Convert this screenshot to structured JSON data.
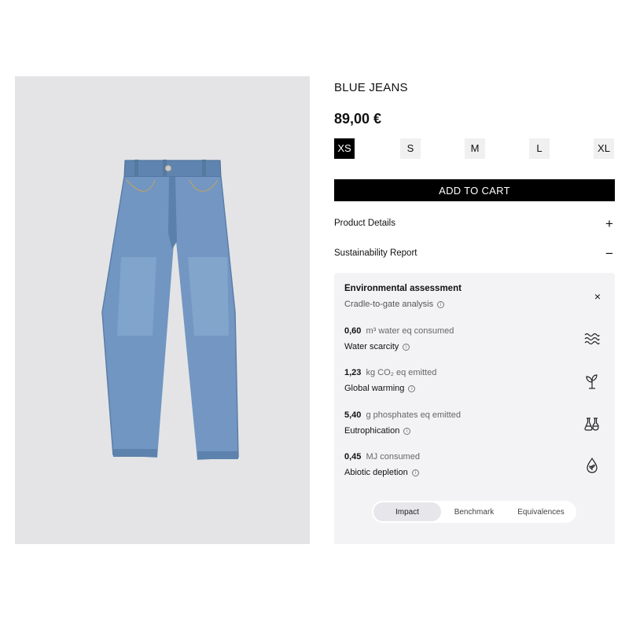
{
  "product": {
    "name": "BLUE JEANS",
    "price": "89,00 €",
    "sizes": [
      {
        "label": "XS",
        "selected": true
      },
      {
        "label": "S",
        "selected": false
      },
      {
        "label": "M",
        "selected": false
      },
      {
        "label": "L",
        "selected": false
      },
      {
        "label": "XL",
        "selected": false
      }
    ],
    "add_to_cart_label": "ADD TO CART"
  },
  "accordion": {
    "product_details": {
      "label": "Product Details",
      "toggle": "+"
    },
    "sustainability": {
      "label": "Sustainability Report",
      "toggle": "−"
    }
  },
  "panel": {
    "title": "Environmental assessment",
    "subtitle": "Cradle-to-gate analysis",
    "close": "×",
    "info_glyph": "i",
    "metrics": [
      {
        "value": "0,60",
        "unit": "m³ water eq consumed",
        "name": "Water scarcity",
        "icon": "water-waves-icon"
      },
      {
        "value": "1,23",
        "unit": "kg CO₂ eq emitted",
        "name": "Global warming",
        "icon": "plant-icon"
      },
      {
        "value": "5,40",
        "unit": "g phosphates eq emitted",
        "name": "Eutrophication",
        "icon": "flasks-icon"
      },
      {
        "value": "0,45",
        "unit": "MJ consumed",
        "name": "Abiotic depletion",
        "icon": "drop-leaf-icon"
      }
    ],
    "tabs": [
      {
        "label": "Impact",
        "active": true
      },
      {
        "label": "Benchmark",
        "active": false
      },
      {
        "label": "Equivalences",
        "active": false
      }
    ]
  },
  "colors": {
    "image_background": "#e4e4e6",
    "denim": "#6f93bd",
    "panel_background": "#f3f3f5",
    "primary_button": "#000000"
  }
}
